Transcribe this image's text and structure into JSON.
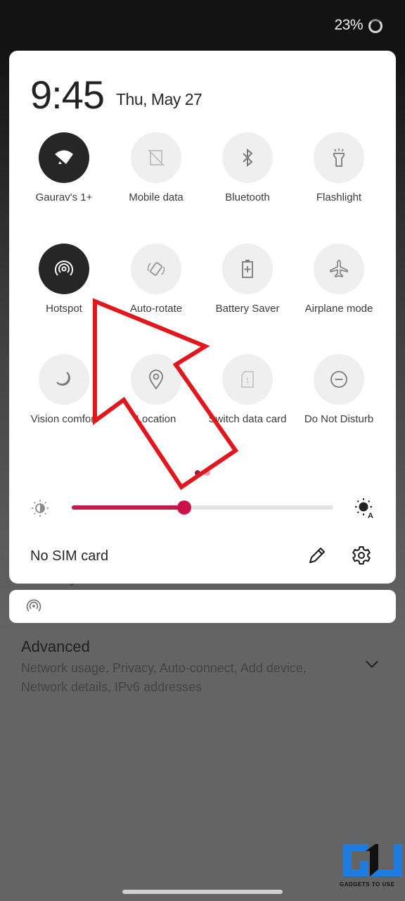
{
  "status_bar": {
    "battery_percent": "23%",
    "battery_icon": "battery-ring-icon"
  },
  "background_app": {
    "security_label": "Security",
    "advanced": {
      "title": "Advanced",
      "subtitle": "Network usage, Privacy, Auto-connect, Add device, Network details, IPv6 addresses",
      "icon": "chevron-down-icon"
    }
  },
  "quick_settings": {
    "time": "9:45",
    "date": "Thu, May 27",
    "tiles": [
      {
        "label": "Gaurav's 1+",
        "icon": "wifi-icon",
        "active": true
      },
      {
        "label": "Mobile data",
        "icon": "mobile-data-off-icon",
        "active": false
      },
      {
        "label": "Bluetooth",
        "icon": "bluetooth-icon",
        "active": false
      },
      {
        "label": "Flashlight",
        "icon": "flashlight-icon",
        "active": false
      },
      {
        "label": "Hotspot",
        "icon": "hotspot-icon",
        "active": true
      },
      {
        "label": "Auto-rotate",
        "icon": "auto-rotate-icon",
        "active": false
      },
      {
        "label": "Battery Saver",
        "icon": "battery-saver-icon",
        "active": false
      },
      {
        "label": "Airplane mode",
        "icon": "airplane-icon",
        "active": false
      },
      {
        "label": "Vision comfort",
        "icon": "moon-icon",
        "active": false
      },
      {
        "label": "Location",
        "icon": "location-pin-icon",
        "active": false
      },
      {
        "label": "Switch data card",
        "icon": "sim-card-icon",
        "active": false
      },
      {
        "label": "Do Not Disturb",
        "icon": "do-not-disturb-icon",
        "active": false
      }
    ],
    "page_indicator": {
      "pages": 2,
      "current": 1
    },
    "brightness": {
      "value_fraction": 0.43,
      "low_icon": "brightness-low-icon",
      "auto_icon": "brightness-auto-icon"
    },
    "footer": {
      "sim_status": "No SIM card",
      "edit_icon": "pencil-icon",
      "settings_icon": "gear-icon"
    }
  },
  "notification": {
    "icon": "hotspot-icon"
  },
  "colors": {
    "accent": "#cc1148",
    "accent_track": "#c2184a",
    "tile_active_bg": "#262626",
    "tile_inactive_bg": "#efefef",
    "annotation_arrow": "#e3161e"
  },
  "watermark": {
    "text": "GADGETS TO USE"
  }
}
